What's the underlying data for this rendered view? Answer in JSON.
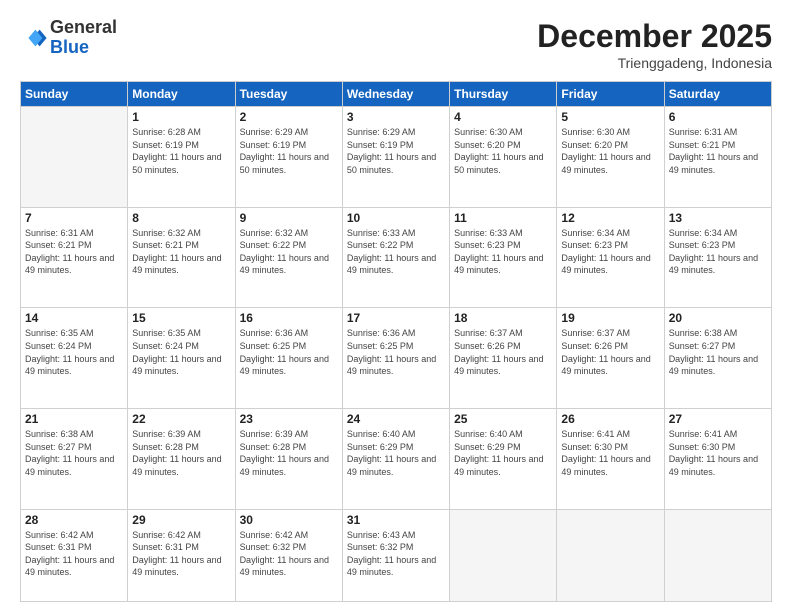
{
  "header": {
    "logo_general": "General",
    "logo_blue": "Blue",
    "month_title": "December 2025",
    "subtitle": "Trienggadeng, Indonesia"
  },
  "days_of_week": [
    "Sunday",
    "Monday",
    "Tuesday",
    "Wednesday",
    "Thursday",
    "Friday",
    "Saturday"
  ],
  "weeks": [
    [
      {
        "day": "",
        "empty": true
      },
      {
        "day": "1",
        "sunrise": "Sunrise: 6:28 AM",
        "sunset": "Sunset: 6:19 PM",
        "daylight": "Daylight: 11 hours and 50 minutes."
      },
      {
        "day": "2",
        "sunrise": "Sunrise: 6:29 AM",
        "sunset": "Sunset: 6:19 PM",
        "daylight": "Daylight: 11 hours and 50 minutes."
      },
      {
        "day": "3",
        "sunrise": "Sunrise: 6:29 AM",
        "sunset": "Sunset: 6:19 PM",
        "daylight": "Daylight: 11 hours and 50 minutes."
      },
      {
        "day": "4",
        "sunrise": "Sunrise: 6:30 AM",
        "sunset": "Sunset: 6:20 PM",
        "daylight": "Daylight: 11 hours and 50 minutes."
      },
      {
        "day": "5",
        "sunrise": "Sunrise: 6:30 AM",
        "sunset": "Sunset: 6:20 PM",
        "daylight": "Daylight: 11 hours and 49 minutes."
      },
      {
        "day": "6",
        "sunrise": "Sunrise: 6:31 AM",
        "sunset": "Sunset: 6:21 PM",
        "daylight": "Daylight: 11 hours and 49 minutes."
      }
    ],
    [
      {
        "day": "7",
        "sunrise": "Sunrise: 6:31 AM",
        "sunset": "Sunset: 6:21 PM",
        "daylight": "Daylight: 11 hours and 49 minutes."
      },
      {
        "day": "8",
        "sunrise": "Sunrise: 6:32 AM",
        "sunset": "Sunset: 6:21 PM",
        "daylight": "Daylight: 11 hours and 49 minutes."
      },
      {
        "day": "9",
        "sunrise": "Sunrise: 6:32 AM",
        "sunset": "Sunset: 6:22 PM",
        "daylight": "Daylight: 11 hours and 49 minutes."
      },
      {
        "day": "10",
        "sunrise": "Sunrise: 6:33 AM",
        "sunset": "Sunset: 6:22 PM",
        "daylight": "Daylight: 11 hours and 49 minutes."
      },
      {
        "day": "11",
        "sunrise": "Sunrise: 6:33 AM",
        "sunset": "Sunset: 6:23 PM",
        "daylight": "Daylight: 11 hours and 49 minutes."
      },
      {
        "day": "12",
        "sunrise": "Sunrise: 6:34 AM",
        "sunset": "Sunset: 6:23 PM",
        "daylight": "Daylight: 11 hours and 49 minutes."
      },
      {
        "day": "13",
        "sunrise": "Sunrise: 6:34 AM",
        "sunset": "Sunset: 6:23 PM",
        "daylight": "Daylight: 11 hours and 49 minutes."
      }
    ],
    [
      {
        "day": "14",
        "sunrise": "Sunrise: 6:35 AM",
        "sunset": "Sunset: 6:24 PM",
        "daylight": "Daylight: 11 hours and 49 minutes."
      },
      {
        "day": "15",
        "sunrise": "Sunrise: 6:35 AM",
        "sunset": "Sunset: 6:24 PM",
        "daylight": "Daylight: 11 hours and 49 minutes."
      },
      {
        "day": "16",
        "sunrise": "Sunrise: 6:36 AM",
        "sunset": "Sunset: 6:25 PM",
        "daylight": "Daylight: 11 hours and 49 minutes."
      },
      {
        "day": "17",
        "sunrise": "Sunrise: 6:36 AM",
        "sunset": "Sunset: 6:25 PM",
        "daylight": "Daylight: 11 hours and 49 minutes."
      },
      {
        "day": "18",
        "sunrise": "Sunrise: 6:37 AM",
        "sunset": "Sunset: 6:26 PM",
        "daylight": "Daylight: 11 hours and 49 minutes."
      },
      {
        "day": "19",
        "sunrise": "Sunrise: 6:37 AM",
        "sunset": "Sunset: 6:26 PM",
        "daylight": "Daylight: 11 hours and 49 minutes."
      },
      {
        "day": "20",
        "sunrise": "Sunrise: 6:38 AM",
        "sunset": "Sunset: 6:27 PM",
        "daylight": "Daylight: 11 hours and 49 minutes."
      }
    ],
    [
      {
        "day": "21",
        "sunrise": "Sunrise: 6:38 AM",
        "sunset": "Sunset: 6:27 PM",
        "daylight": "Daylight: 11 hours and 49 minutes."
      },
      {
        "day": "22",
        "sunrise": "Sunrise: 6:39 AM",
        "sunset": "Sunset: 6:28 PM",
        "daylight": "Daylight: 11 hours and 49 minutes."
      },
      {
        "day": "23",
        "sunrise": "Sunrise: 6:39 AM",
        "sunset": "Sunset: 6:28 PM",
        "daylight": "Daylight: 11 hours and 49 minutes."
      },
      {
        "day": "24",
        "sunrise": "Sunrise: 6:40 AM",
        "sunset": "Sunset: 6:29 PM",
        "daylight": "Daylight: 11 hours and 49 minutes."
      },
      {
        "day": "25",
        "sunrise": "Sunrise: 6:40 AM",
        "sunset": "Sunset: 6:29 PM",
        "daylight": "Daylight: 11 hours and 49 minutes."
      },
      {
        "day": "26",
        "sunrise": "Sunrise: 6:41 AM",
        "sunset": "Sunset: 6:30 PM",
        "daylight": "Daylight: 11 hours and 49 minutes."
      },
      {
        "day": "27",
        "sunrise": "Sunrise: 6:41 AM",
        "sunset": "Sunset: 6:30 PM",
        "daylight": "Daylight: 11 hours and 49 minutes."
      }
    ],
    [
      {
        "day": "28",
        "sunrise": "Sunrise: 6:42 AM",
        "sunset": "Sunset: 6:31 PM",
        "daylight": "Daylight: 11 hours and 49 minutes."
      },
      {
        "day": "29",
        "sunrise": "Sunrise: 6:42 AM",
        "sunset": "Sunset: 6:31 PM",
        "daylight": "Daylight: 11 hours and 49 minutes."
      },
      {
        "day": "30",
        "sunrise": "Sunrise: 6:42 AM",
        "sunset": "Sunset: 6:32 PM",
        "daylight": "Daylight: 11 hours and 49 minutes."
      },
      {
        "day": "31",
        "sunrise": "Sunrise: 6:43 AM",
        "sunset": "Sunset: 6:32 PM",
        "daylight": "Daylight: 11 hours and 49 minutes."
      },
      {
        "day": "",
        "empty": true
      },
      {
        "day": "",
        "empty": true
      },
      {
        "day": "",
        "empty": true
      }
    ]
  ]
}
